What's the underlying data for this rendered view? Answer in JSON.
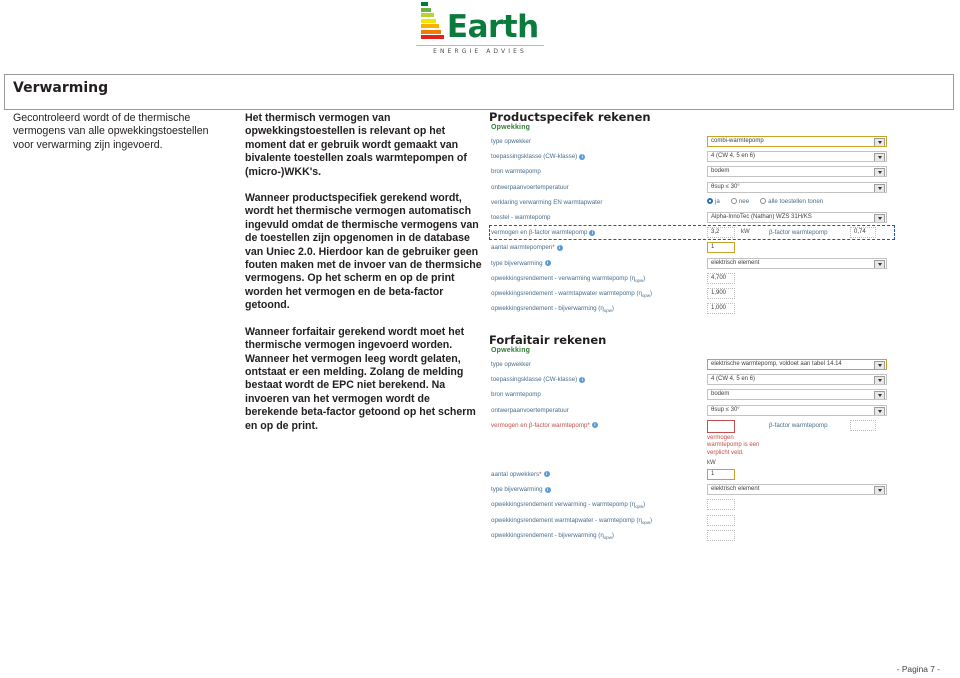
{
  "logo": {
    "word": "Earth",
    "subtitle": "ENERGIE ADVIES",
    "bar_colors": [
      "#007a3d",
      "#6cb33f",
      "#b7d432",
      "#f4e400",
      "#f9b000",
      "#f07d00",
      "#e2231a"
    ]
  },
  "section": {
    "title": "Verwarming"
  },
  "columns": {
    "left": [
      "Gecontroleerd wordt of de thermische vermogens van alle opwekkingstoestellen voor verwarming zijn ingevoerd."
    ],
    "middle": [
      "Het thermisch vermogen van opwekkingstoestellen is relevant op het moment dat er gebruik wordt gemaakt van bivalente toestellen zoals warmtepompen of (micro-)WKK's.",
      "Wanneer productspecifiek gerekend wordt, wordt het thermische vermogen automatisch ingevuld omdat de thermische vermogens van de toestellen zijn opgenomen in de database van Uniec 2.0. Hierdoor kan de gebruiker geen fouten maken met de invoer van de thermsiche vermogens. Op het scherm en op de print worden het vermogen en de beta-factor getoond.",
      "Wanneer forfaitair gerekend wordt moet het thermische vermogen ingevoerd worden. Wanneer het vermogen leeg wordt gelaten, ontstaat er een melding. Zolang de melding bestaat wordt de EPC niet berekend. Na invoeren van het vermogen wordt de berekende beta-factor getoond op het scherm en op de print."
    ]
  },
  "productspecifiek": {
    "title": "Productspecifek rekenen",
    "group": "Opwekking",
    "fields": [
      {
        "label": "type opwekker",
        "value": "combi-warmtepomp",
        "control": "select",
        "style": "gold"
      },
      {
        "label": "toepassingsklasse (CW-klasse)",
        "value": "4 (CW 4, 5 en 6)",
        "control": "select",
        "info": true
      },
      {
        "label": "bron warmtepomp",
        "value": "bodem",
        "control": "select"
      },
      {
        "label": "ontwerpaanvoertemperatuur",
        "value": "θsup ≤ 30°",
        "control": "select"
      },
      {
        "label": "verklaring verwarming EN warmtapwater",
        "control": "radio"
      },
      {
        "label": "toestel - warmtepomp",
        "value": "Alpha-InnoTec (Nathan) WZS 31H/KS",
        "control": "select"
      },
      {
        "label": "vermogen en β-factor warmtepomp",
        "value": "3,2",
        "control": "power",
        "info": true,
        "unit": "kW",
        "beta_label": "β-factor warmtepomp",
        "beta_value": "0,74",
        "highlight": true
      },
      {
        "label": "aantal warmtepompen",
        "value": "1",
        "control": "small",
        "required": true,
        "info": true
      },
      {
        "label": "type bijverwarming",
        "value": "elektrisch element",
        "control": "select",
        "info": true
      },
      {
        "label": "opwekkingsrendement - verwarming warmtepomp (η|opw)",
        "value": "4,700",
        "control": "dash"
      },
      {
        "label": "opwekkingsrendement - warmtapwater warmtepomp (η|opw)",
        "value": "1,900",
        "control": "dash"
      },
      {
        "label": "opwekkingsrendement - bijverwarming (η|opw)",
        "value": "1,000",
        "control": "dash"
      }
    ],
    "radio_options": [
      {
        "label": "ja",
        "selected": true
      },
      {
        "label": "nee",
        "selected": false
      },
      {
        "label": "alle toestellen tonen",
        "selected": false
      }
    ]
  },
  "forfaitair": {
    "title": "Forfaitair rekenen",
    "group": "Opwekking",
    "fields": [
      {
        "label": "type opwekker",
        "value": "elektrische warmtepomp, voldoet aan tabel 14.14",
        "control": "select",
        "style": "gold"
      },
      {
        "label": "toepassingsklasse (CW-klasse)",
        "value": "4 (CW 4, 5 en 6)",
        "control": "select",
        "info": true
      },
      {
        "label": "bron warmtepomp",
        "value": "bodem",
        "control": "select"
      },
      {
        "label": "ontwerpaanvoertemperatuur",
        "value": "θsup ≤ 30°",
        "control": "select"
      },
      {
        "label": "vermogen en β-factor warmtepomp",
        "value": "",
        "control": "power",
        "required": true,
        "info": true,
        "error": true,
        "beta_label": "β-factor warmtepomp",
        "beta_value": "",
        "unit": "kW"
      },
      {
        "label": "aantal opwekkers",
        "value": "1",
        "control": "small",
        "required": true,
        "info": true
      },
      {
        "label": "type bijverwarming",
        "value": "elektrisch element",
        "control": "select",
        "info": true
      },
      {
        "label": "opwekkingsrendement verwarming - warmtepomp (η|opw)",
        "value": "",
        "control": "dash"
      },
      {
        "label": "opwekkingsrendement warmtapwater - warmtepomp (η|opw)",
        "value": "",
        "control": "dash"
      },
      {
        "label": "opwekkingsrendement - bijverwarming (η|opw)",
        "value": "",
        "control": "dash"
      }
    ],
    "error_message": "vermogen warmtepomp is een verplicht veld."
  },
  "footer": {
    "page": "- Pagina 7 -"
  }
}
